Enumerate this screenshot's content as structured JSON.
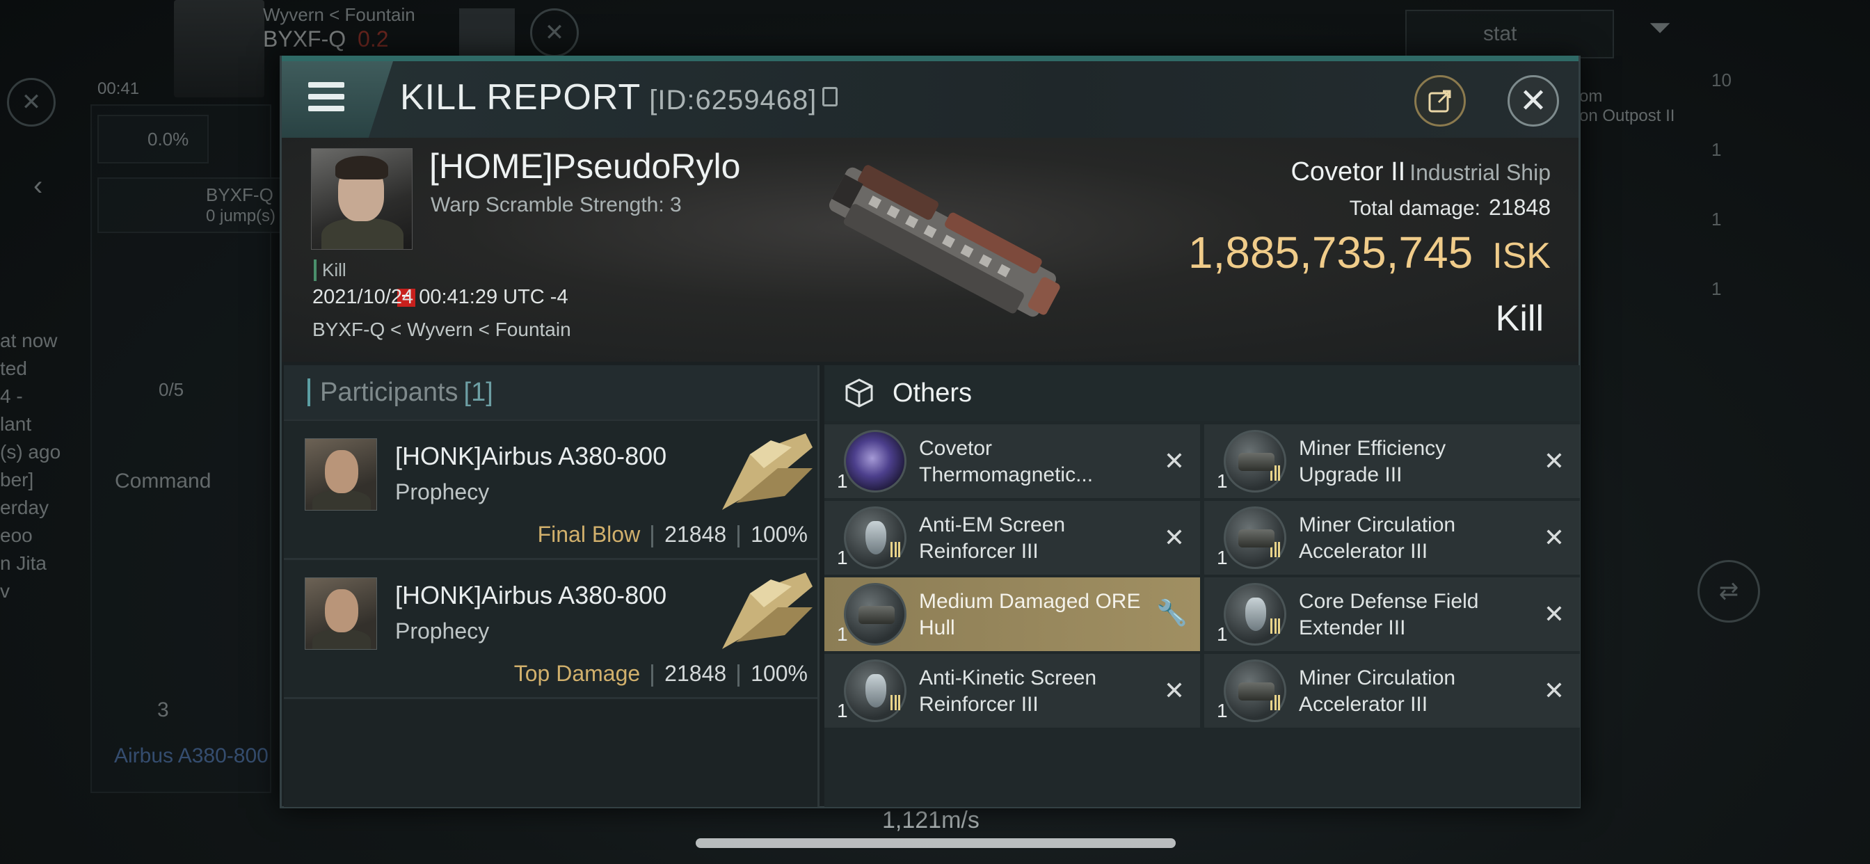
{
  "hud": {
    "region_path": "Wyvern < Fountain",
    "system": "BYXF-Q",
    "security": "0.2",
    "clock": "00:41",
    "percent": "0.0%",
    "route_system": "BYXF-Q",
    "route_jumps": "0 jump(s)",
    "capacity": "0/5",
    "command_label": "Command",
    "local_count": "3",
    "pilot_link": "Airbus A380-800",
    "overview_tab": "stat",
    "speed": "1,121m/s",
    "right_counts": [
      "10",
      "1",
      "1",
      "1"
    ],
    "side_snippets": [
      "at now",
      "ted",
      "4 -",
      "lant",
      "(s) ago",
      "ber]",
      "erday",
      "eoo",
      "n Jita",
      "v"
    ],
    "location_card": [
      "om",
      "on Outpost II"
    ]
  },
  "report": {
    "title": "KILL REPORT",
    "id_text": "[ID:6259468]",
    "victim": {
      "name": "[HOME]PseudoRylo",
      "subtitle": "Warp Scramble Strength: 3",
      "kill_tag": "Kill",
      "datetime": "2021/10/24 00:41:29 UTC -4",
      "location": "BYXF-Q < Wyvern < Fountain",
      "ship_name": "Covetor II",
      "ship_class": "Industrial Ship",
      "total_damage_label": "Total damage:",
      "total_damage_value": "21848",
      "isk_value": "1,885,735,745",
      "isk_unit": "ISK",
      "result": "Kill"
    },
    "participants": {
      "label": "Participants",
      "count": "[1]",
      "rows": [
        {
          "name": "[HONK]Airbus A380-800",
          "ship": "Prophecy",
          "tag": "Final Blow",
          "damage": "21848",
          "percent": "100%"
        },
        {
          "name": "[HONK]Airbus A380-800",
          "ship": "Prophecy",
          "tag": "Top Damage",
          "damage": "21848",
          "percent": "100%"
        }
      ]
    },
    "others": {
      "label": "Others",
      "items": [
        {
          "qty": "1",
          "name": "Covetor Thermomagnetic...",
          "status": "destroyed",
          "icon": "purple"
        },
        {
          "qty": "1",
          "name": "Miner Efficiency Upgrade III",
          "status": "destroyed",
          "icon": "tool"
        },
        {
          "qty": "1",
          "name": "Anti-EM Screen Reinforcer III",
          "status": "destroyed",
          "icon": "shield"
        },
        {
          "qty": "1",
          "name": "Miner Circulation Accelerator III",
          "status": "destroyed",
          "icon": "tool"
        },
        {
          "qty": "1",
          "name": "Medium Damaged ORE Hull",
          "status": "dropped",
          "icon": "tool"
        },
        {
          "qty": "1",
          "name": "Core Defense Field Extender III",
          "status": "destroyed",
          "icon": "shield"
        },
        {
          "qty": "1",
          "name": "Anti-Kinetic Screen Reinforcer III",
          "status": "destroyed",
          "icon": "shield"
        },
        {
          "qty": "1",
          "name": "Miner Circulation Accelerator III",
          "status": "destroyed",
          "icon": "tool"
        }
      ]
    }
  },
  "colors": {
    "accent": "#2f6a66",
    "isk": "#f0cc8a",
    "tag": "#d1b06c",
    "highlight": "#a08f62"
  }
}
